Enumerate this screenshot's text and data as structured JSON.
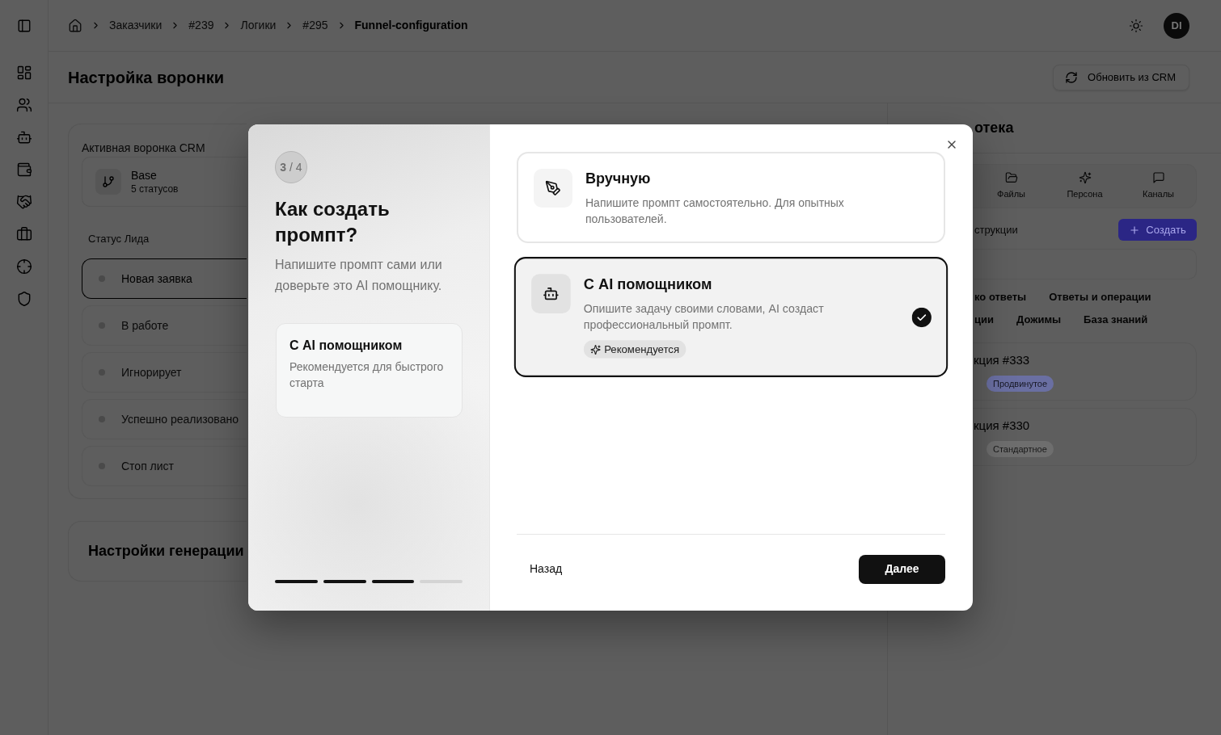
{
  "breadcrumbs": [
    {
      "label": "Заказчики",
      "current": false
    },
    {
      "label": "#239",
      "current": false
    },
    {
      "label": "Логики",
      "current": false
    },
    {
      "label": "#295",
      "current": false
    },
    {
      "label": "Funnel-configuration",
      "current": true
    }
  ],
  "user": {
    "initials": "DI"
  },
  "page": {
    "title": "Настройка воронки",
    "refresh_button": "Обновить из CRM"
  },
  "funnel_card": {
    "label": "Активная воронка CRM",
    "funnel_name": "Base",
    "funnel_meta": "5 статусов",
    "status_label": "Статус Лида",
    "statuses": [
      {
        "name": "Новая заявка",
        "selected": true
      },
      {
        "name": "В работе",
        "selected": false
      },
      {
        "name": "Игнорирует",
        "selected": false
      },
      {
        "name": "Успешно реализовано",
        "selected": false
      },
      {
        "name": "Стоп лист",
        "selected": false
      }
    ]
  },
  "generation_card": {
    "title": "Настройки генерации"
  },
  "library": {
    "title": "отека",
    "tabs": [
      {
        "kind": "files",
        "label": "Файлы"
      },
      {
        "kind": "persona",
        "label": "Персона"
      },
      {
        "kind": "channels",
        "label": "Каналы"
      }
    ],
    "section_label": "струкции",
    "create_button": "Создать",
    "filter_rows": [
      [
        "ко ответы",
        "Ответы и операции"
      ],
      [
        "ции",
        "Дожимы",
        "База знаний"
      ]
    ],
    "instructions": [
      {
        "title": "кция #333",
        "tag": {
          "label": "Продвинутое",
          "color": "#6a6fa2"
        }
      },
      {
        "title": "кция #330",
        "tag": {
          "label": "Стандартное",
          "color": "#6e6e6e"
        }
      }
    ]
  },
  "modal": {
    "step": "**3** / 4",
    "title": "Как создать промпт?",
    "subtitle": "Напишите промпт сами или доверьте это AI помощнику.",
    "summary": {
      "title": "С AI помощником",
      "text": "Рекомендуется для быстрого старта"
    },
    "progress_steps": [
      {
        "done": true
      },
      {
        "done": true
      },
      {
        "done": true
      },
      {
        "done": false
      }
    ],
    "options": [
      {
        "kind": "manual",
        "title": "Вручную",
        "description": "Напишите промпт самостоятельно. Для опытных пользователей.",
        "selected": false
      },
      {
        "kind": "ai",
        "title": "С AI помощником",
        "description": "Опишите задачу своими словами, AI создаст профессиональный промпт.",
        "badge": "Рекомендуется",
        "selected": true
      }
    ],
    "back_button": "Назад",
    "next_button": "Далее"
  }
}
